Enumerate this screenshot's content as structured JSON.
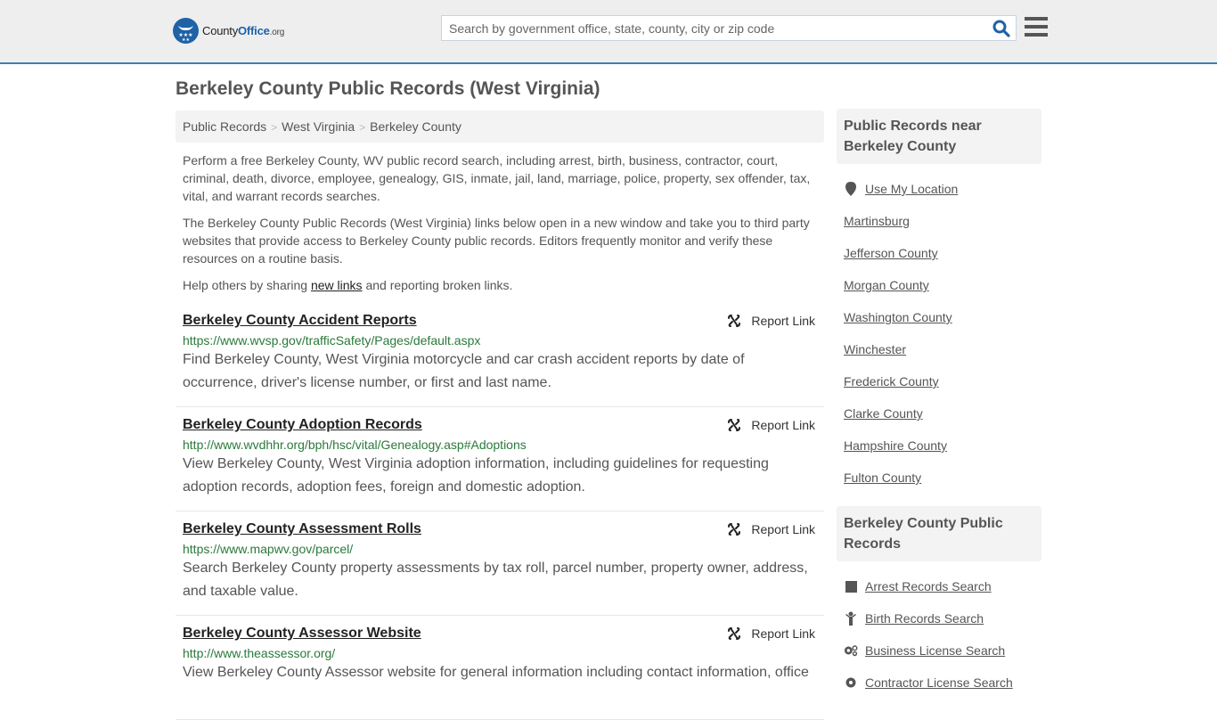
{
  "header": {
    "logo": {
      "brand_main": "County",
      "brand_accent": "Office",
      "brand_tld": ".org"
    },
    "search": {
      "placeholder": "Search by government office, state, county, city or zip code",
      "value": "",
      "icon": "search-icon"
    },
    "menu_icon": "hamburger-menu-icon",
    "accent_color": "#3c80b4"
  },
  "page": {
    "title": "Berkeley County Public Records (West Virginia)",
    "breadcrumb": [
      "Public Records",
      "West Virginia",
      "Berkeley County"
    ],
    "breadcrumb_separator": ">",
    "intro": {
      "p1": "Perform a free Berkeley County, WV public record search, including arrest, birth, business, contractor, court, criminal, death, divorce, employee, genealogy, GIS, inmate, jail, land, marriage, police, property, sex offender, tax, vital, and warrant records searches.",
      "p2": "The Berkeley County Public Records (West Virginia) links below open in a new window and take you to third party websites that provide access to Berkeley County public records. Editors frequently monitor and verify these resources on a routine basis.",
      "p3_before": "Help others by sharing ",
      "p3_link": "new links",
      "p3_after": " and reporting broken links."
    }
  },
  "records": [
    {
      "title": "Berkeley County Accident Reports",
      "url": "https://www.wvsp.gov/trafficSafety/Pages/default.aspx",
      "description": "Find Berkeley County, West Virginia motorcycle and car crash accident reports by date of occurrence, driver's license number, or first and last name.",
      "report_label": "Report Link"
    },
    {
      "title": "Berkeley County Adoption Records",
      "url": "http://www.wvdhhr.org/bph/hsc/vital/Genealogy.asp#Adoptions",
      "description": "View Berkeley County, West Virginia adoption information, including guidelines for requesting adoption records, adoption fees, foreign and domestic adoption.",
      "report_label": "Report Link"
    },
    {
      "title": "Berkeley County Assessment Rolls",
      "url": "https://www.mapwv.gov/parcel/",
      "description": "Search Berkeley County property assessments by tax roll, parcel number, property owner, address, and taxable value.",
      "report_label": "Report Link"
    },
    {
      "title": "Berkeley County Assessor Website",
      "url": "http://www.theassessor.org/",
      "description": "View Berkeley County Assessor website for general information including contact information, office",
      "report_label": "Report Link"
    }
  ],
  "sidebar": {
    "nearby": {
      "heading": "Public Records near Berkeley County",
      "use_location": "Use My Location",
      "items": [
        "Martinsburg",
        "Jefferson County",
        "Morgan County",
        "Washington County",
        "Winchester",
        "Frederick County",
        "Clarke County",
        "Hampshire County",
        "Fulton County"
      ]
    },
    "records": {
      "heading": "Berkeley County Public Records",
      "items": [
        {
          "label": "Arrest Records Search",
          "icon": "square-icon"
        },
        {
          "label": "Birth Records Search",
          "icon": "child-icon"
        },
        {
          "label": "Business License Search",
          "icon": "cogs-icon"
        },
        {
          "label": "Contractor License Search",
          "icon": "gear-icon"
        }
      ]
    }
  }
}
